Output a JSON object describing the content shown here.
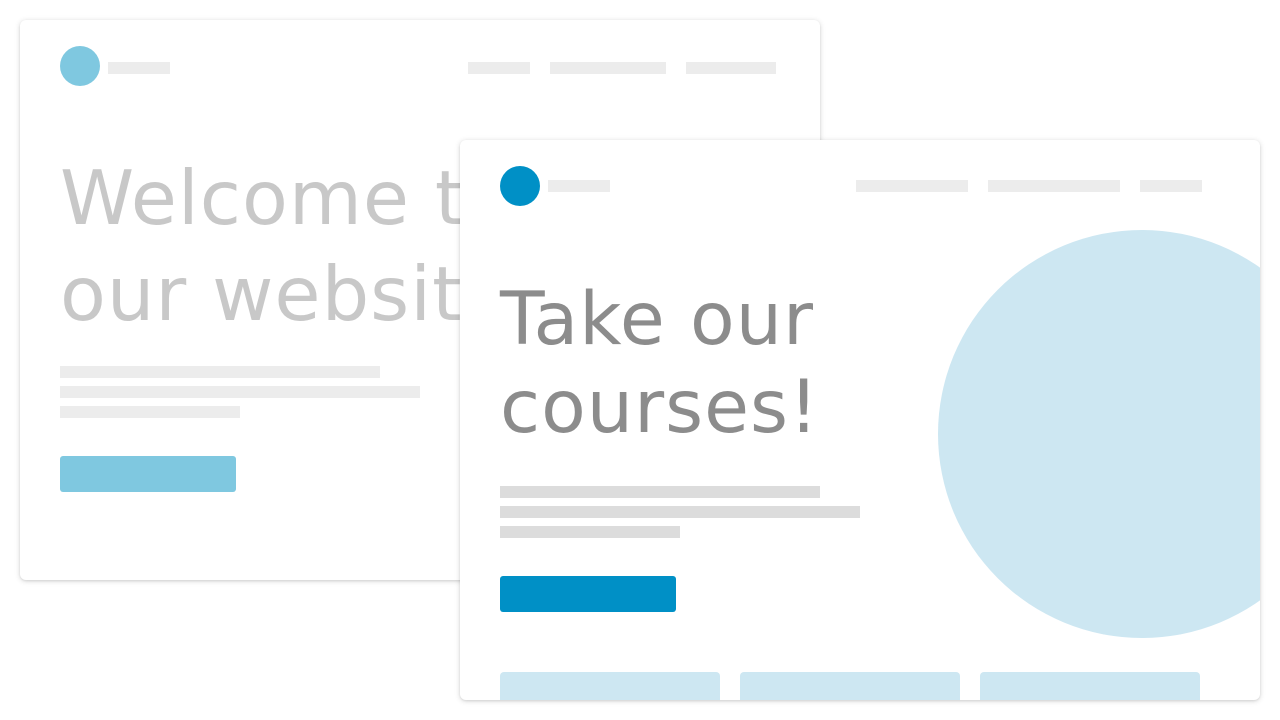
{
  "colors": {
    "back_logo": "#7fc8e0",
    "back_button": "#7fc8e0",
    "back_headline": "#c8c8c8",
    "front_logo": "#0090c6",
    "front_button": "#0090c6",
    "front_headline": "#8c8c8c",
    "light_blue": "#cde7f2",
    "nav_placeholder": "#ececec",
    "text_placeholder_back": "#ececec",
    "text_placeholder_front": "#dcdcdc"
  },
  "back_card": {
    "headline": "Welcome to\nour website"
  },
  "front_card": {
    "headline": "Take our\ncourses!"
  }
}
